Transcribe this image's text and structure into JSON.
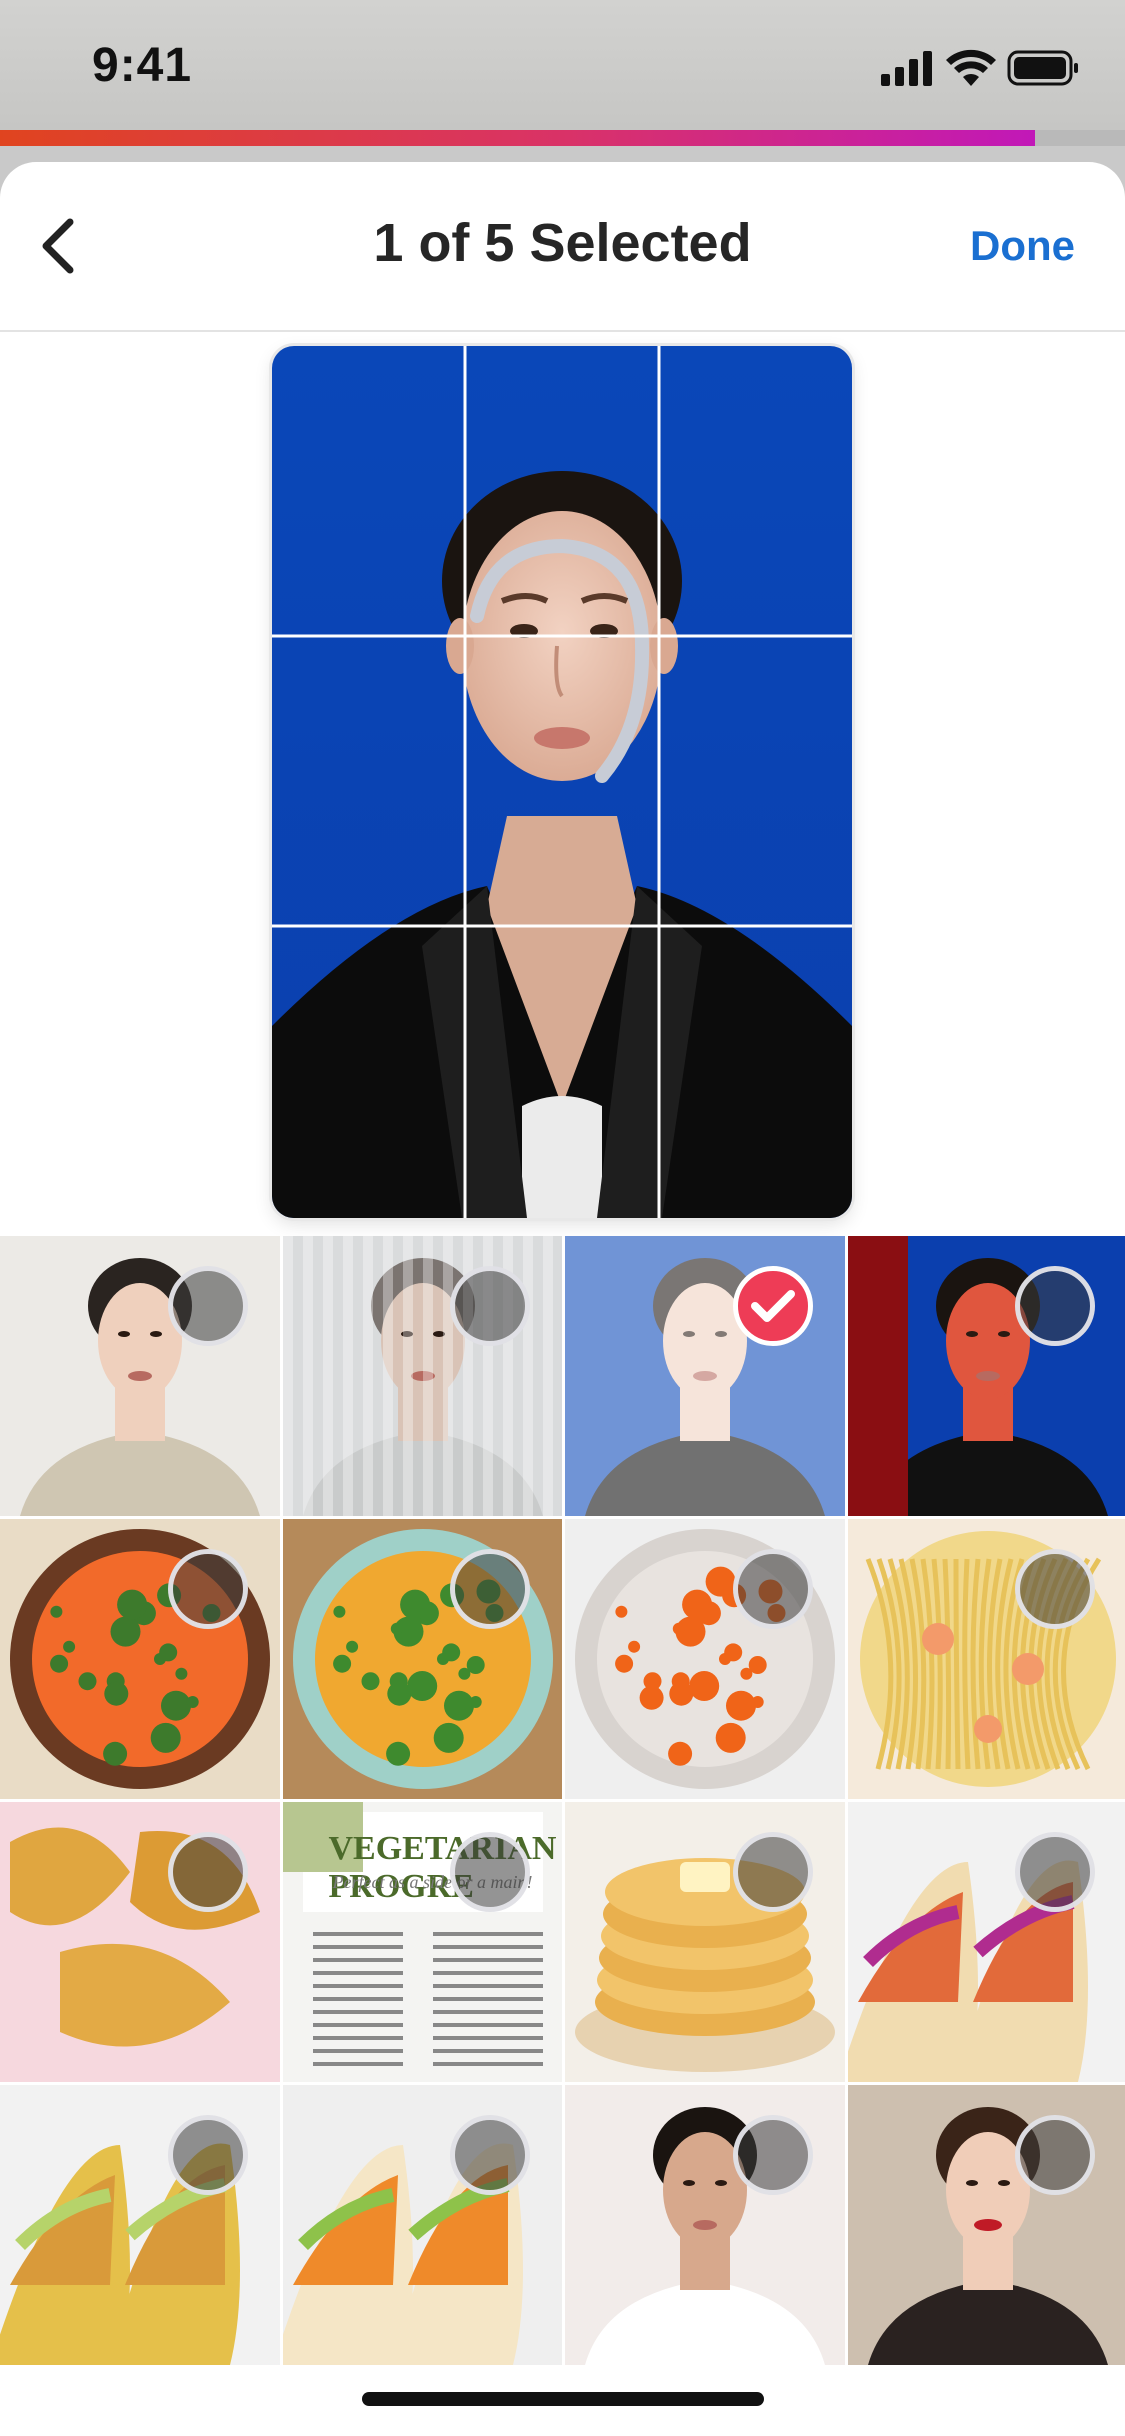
{
  "status_bar": {
    "time": "9:41",
    "icons": [
      "signal-icon",
      "wifi-icon",
      "battery-icon"
    ]
  },
  "upload_progress": 0.92,
  "header": {
    "back_icon": "chevron-left-icon",
    "title": "1 of 5 Selected",
    "done_label": "Done"
  },
  "preview": {
    "subject": "woman-blue-background",
    "grid": "3x3"
  },
  "gallery": {
    "items": [
      {
        "subject": "woman-beige-coat",
        "selected": false
      },
      {
        "subject": "woman-behind-glass",
        "selected": false
      },
      {
        "subject": "woman-blue-background",
        "selected": true
      },
      {
        "subject": "woman-red-light",
        "selected": false
      },
      {
        "subject": "tomato-soup",
        "selected": false
      },
      {
        "subject": "vegetable-soup",
        "selected": false
      },
      {
        "subject": "roasted-carrots",
        "selected": false
      },
      {
        "subject": "shrimp-pasta",
        "selected": false
      },
      {
        "subject": "empanadas",
        "selected": false
      },
      {
        "subject": "recipe-card",
        "selected": false,
        "title": "VEGETARIAN PROGRE",
        "subtitle": "Perfect as a side or a main!"
      },
      {
        "subject": "pancakes",
        "selected": false
      },
      {
        "subject": "tacos-cabbage",
        "selected": false
      },
      {
        "subject": "tacos-lettuce",
        "selected": false
      },
      {
        "subject": "fish-tacos",
        "selected": false
      },
      {
        "subject": "man-white-tshirt",
        "selected": false
      },
      {
        "subject": "woman-red-lips",
        "selected": false
      }
    ]
  },
  "colors": {
    "accent": "#1a6fd1",
    "selected": "#ee3c56",
    "progress_start": "#e0441f",
    "progress_end": "#c118b8"
  }
}
